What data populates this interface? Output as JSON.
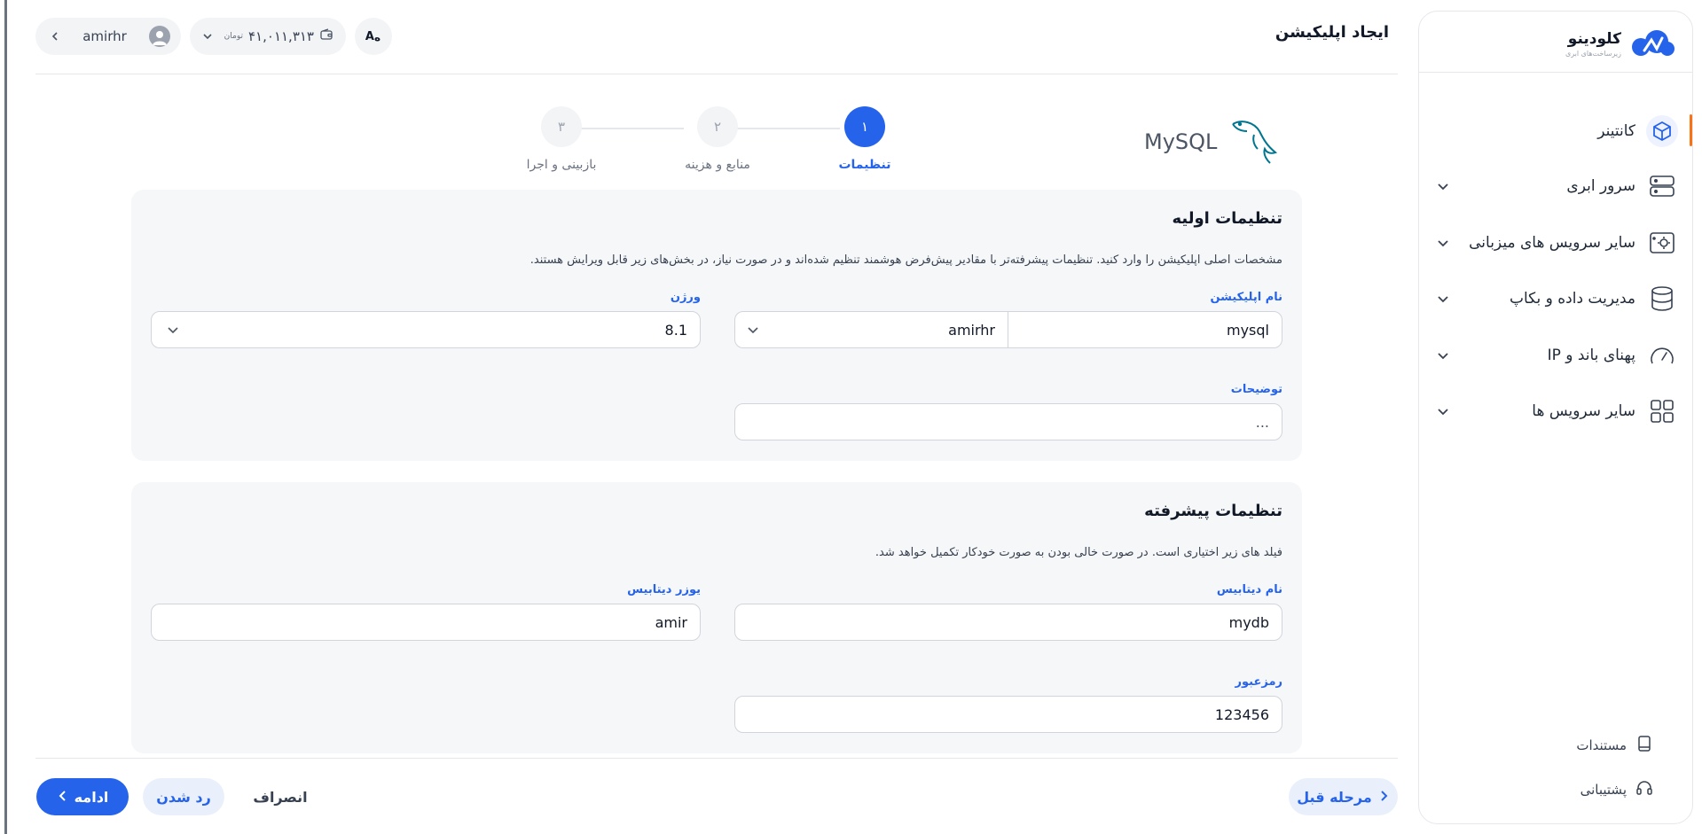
{
  "sidebar": {
    "logo_title": "کلودینو",
    "logo_subtitle": "زیرساخت‌های ابری",
    "items": [
      {
        "label": "کانتینر",
        "icon": "container-icon",
        "active": true
      },
      {
        "label": "سرور ابری",
        "icon": "server-icon"
      },
      {
        "label": "سایر سرویس های میزبانی",
        "icon": "hosting-gear-icon"
      },
      {
        "label": "مدیریت داده و بکاپ",
        "icon": "database-icon"
      },
      {
        "label": "پهنای باند و IP",
        "icon": "speedometer-icon"
      },
      {
        "label": "سایر سرویس ها",
        "icon": "grid-icon"
      }
    ],
    "docs_label": "مستندات",
    "support_label": "پشتیبانی"
  },
  "header": {
    "title": "ایجاد اپلیکیشن",
    "username": "amirhr",
    "wallet_amount": "۴۱,۰۱۱,۳۱۳",
    "wallet_unit": "تومان",
    "lang_button": "A"
  },
  "app": {
    "name": "MySQL"
  },
  "stepper": {
    "steps": [
      {
        "number": "۱",
        "label": "تنظیمات",
        "active": true
      },
      {
        "number": "۲",
        "label": "منابع و هزینه"
      },
      {
        "number": "۳",
        "label": "بازبینی و اجرا"
      }
    ]
  },
  "basic": {
    "title": "تنظیمات اولیه",
    "description": "مشخصات اصلی اپلیکیشن را وارد کنید. تنظیمات پیشرفته‌تر با مقادیر پیش‌فرض هوشمند تنظیم شده‌اند و در صورت نیاز، در بخش‌های زیر قابل ویرایش هستند.",
    "app_name_label": "نام اپلیکیشن",
    "app_name_value": "mysql",
    "namespace_value": "amirhr",
    "version_label": "ورژن",
    "version_value": "8.1",
    "description_label": "توضیحات",
    "description_placeholder": "..."
  },
  "advanced": {
    "title": "تنظیمات پیشرفته",
    "description": "فیلد های زیر اختیاری است. در صورت خالی بودن به صورت خودکار تکمیل خواهد شد.",
    "db_name_label": "نام دیتابیس",
    "db_name_value": "mydb",
    "db_user_label": "یوزر دیتابیس",
    "db_user_value": "amir",
    "password_label": "رمزعبور",
    "password_value": "123456"
  },
  "footer": {
    "next_label": "ادامه",
    "reject_label": "رد شدن",
    "cancel_label": "انصراف",
    "prev_label": "مرحله قبل"
  },
  "colors": {
    "primary": "#2563eb",
    "accent": "#f97316",
    "mysql": "#00758f"
  }
}
